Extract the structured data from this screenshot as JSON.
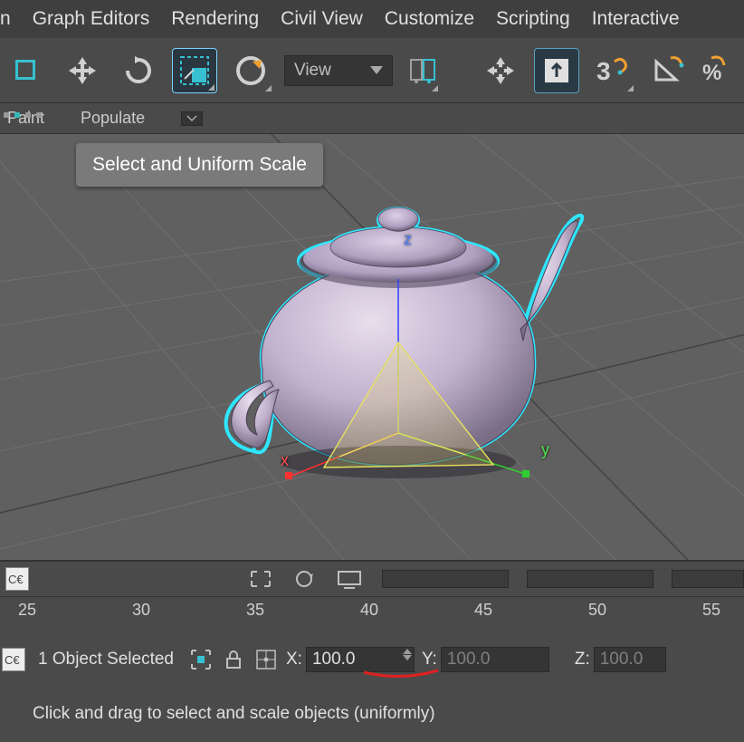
{
  "menu": {
    "items": [
      "n",
      "Graph Editors",
      "Rendering",
      "Civil View",
      "Customize",
      "Scripting",
      "Interactive"
    ]
  },
  "toolbar": {
    "coord_dropdown": "View"
  },
  "subtoolbar": {
    "items": [
      "Paint",
      "Populate"
    ]
  },
  "tooltip": "Select and Uniform Scale",
  "viewport": {
    "axis_x": "x",
    "axis_y": "y",
    "axis_z": "z"
  },
  "timeline": {
    "ticks": [
      25,
      30,
      35,
      40,
      45,
      50,
      55
    ]
  },
  "track": {
    "btn1": "C€"
  },
  "status": {
    "btn1": "C€",
    "selected": "1 Object Selected",
    "x_label": "X:",
    "y_label": "Y:",
    "z_label": "Z:",
    "x_value": "100.0",
    "y_value": "100.0",
    "z_value": "100.0"
  },
  "hint": "Click and drag to select and scale objects (uniformly)"
}
